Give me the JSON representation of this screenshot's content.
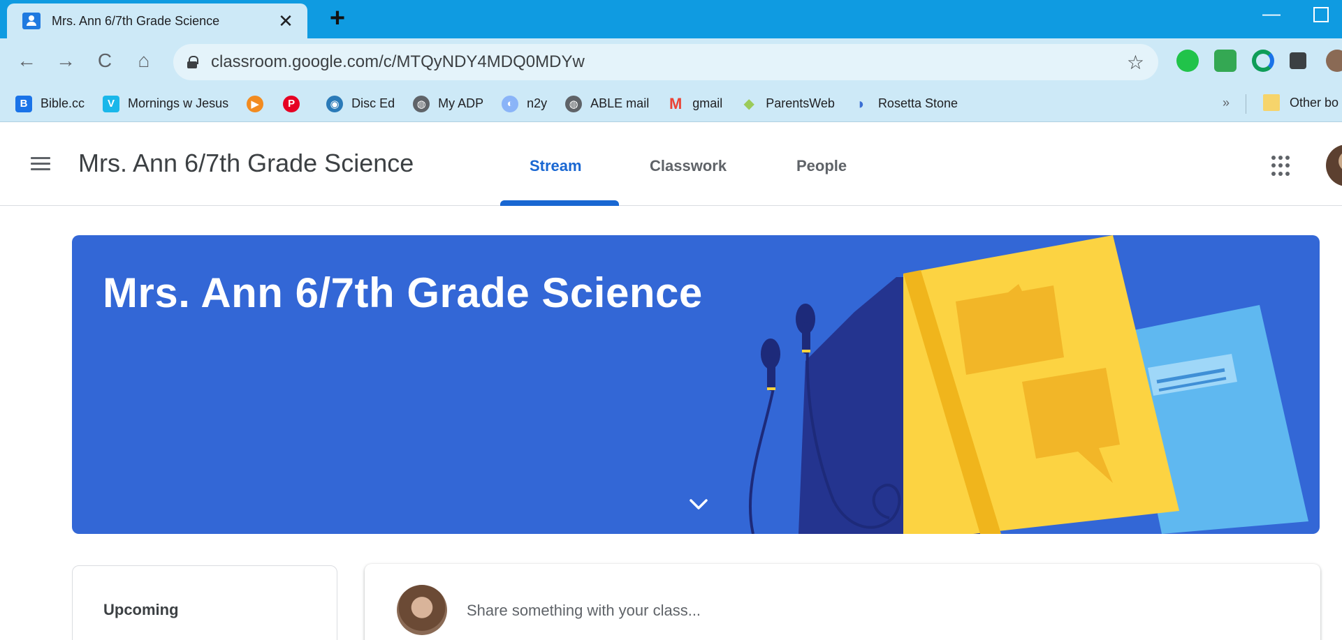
{
  "browser": {
    "tab_title": "Mrs. Ann 6/7th Grade Science",
    "tab_close": "✕",
    "new_tab": "+",
    "url": "classroom.google.com/c/MTQyNDY4MDQ0MDYw",
    "back": "←",
    "forward": "→",
    "reload": "C",
    "home": "⌂",
    "star": "☆",
    "minimize": "—"
  },
  "bookmarks": {
    "items": [
      {
        "label": "Bible.cc",
        "icon": "B",
        "color": "#1a73e8"
      },
      {
        "label": "Mornings w Jesus",
        "icon": "V",
        "color": "#1ab7ea"
      },
      {
        "label": "",
        "icon": "▶",
        "color": "#f28b20"
      },
      {
        "label": "",
        "icon": "P",
        "color": "#e60023"
      },
      {
        "label": "Disc Ed",
        "icon": "◉",
        "color": "#2a7ab8"
      },
      {
        "label": "My ADP",
        "icon": "◍",
        "color": "#5f6368"
      },
      {
        "label": "n2y",
        "icon": "◐",
        "color": "#8ab4f8"
      },
      {
        "label": "ABLE mail",
        "icon": "◍",
        "color": "#5f6368"
      },
      {
        "label": "gmail",
        "icon": "M",
        "color": "#ea4335"
      },
      {
        "label": "ParentsWeb",
        "icon": "◆",
        "color": "#9bcb5a"
      },
      {
        "label": "Rosetta Stone",
        "icon": "◗",
        "color": "#3b6fd4"
      }
    ],
    "more": "»",
    "other": "Other bo"
  },
  "classroom": {
    "title": "Mrs. Ann 6/7th Grade Science",
    "tabs": {
      "stream": "Stream",
      "classwork": "Classwork",
      "people": "People"
    },
    "banner_title": "Mrs. Ann 6/7th Grade Science",
    "upcoming": "Upcoming",
    "share_placeholder": "Share something with your class..."
  },
  "colors": {
    "tabstrip": "#0f9be1",
    "toolbar": "#cde9f7",
    "accent": "#1967d2",
    "banner": "#3367d6"
  }
}
